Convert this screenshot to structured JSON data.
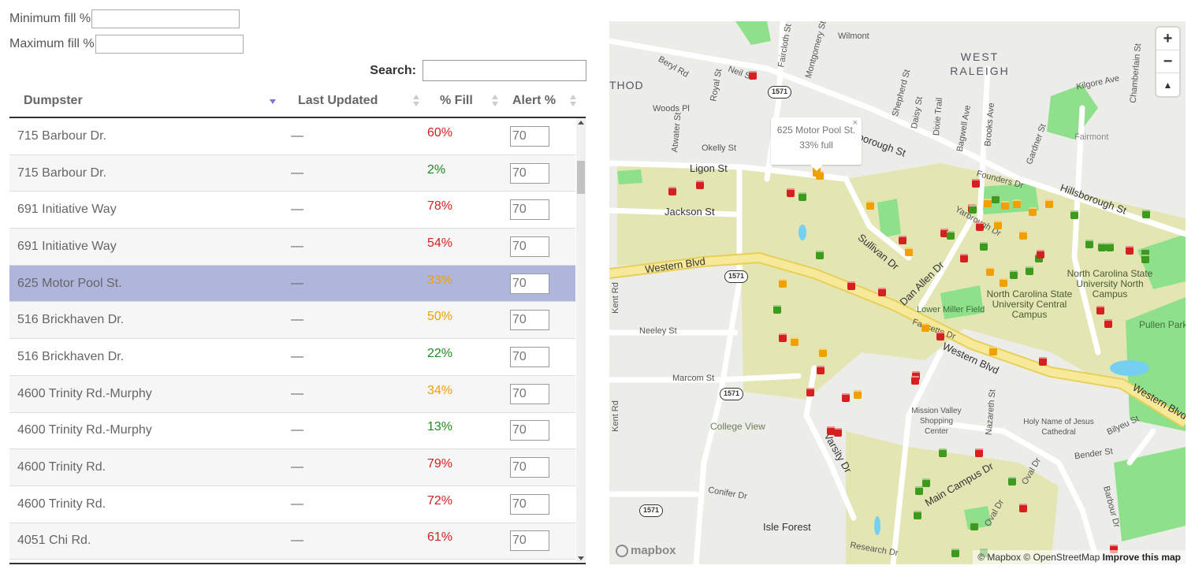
{
  "filters": {
    "min_label": "Minimum fill %",
    "max_label": "Maximum fill %",
    "search_label": "Search:",
    "min_value": "",
    "max_value": "",
    "search_value": ""
  },
  "table": {
    "columns": [
      "Dumpster",
      "Last Updated",
      "% Fill",
      "Alert %"
    ],
    "rows": [
      {
        "name": "715 Barbour Dr.",
        "updated": "—",
        "fill": "60%",
        "color": "#d62020",
        "alert": "70"
      },
      {
        "name": "715 Barbour Dr.",
        "updated": "—",
        "fill": "2%",
        "color": "#1e8a1e",
        "alert": "70"
      },
      {
        "name": "691 Initiative Way",
        "updated": "—",
        "fill": "78%",
        "color": "#d62020",
        "alert": "70"
      },
      {
        "name": "691 Initiative Way",
        "updated": "—",
        "fill": "54%",
        "color": "#d62020",
        "alert": "70"
      },
      {
        "name": "625 Motor Pool St.",
        "updated": "—",
        "fill": "33%",
        "color": "#f0a000",
        "alert": "70",
        "selected": true
      },
      {
        "name": "516 Brickhaven Dr.",
        "updated": "—",
        "fill": "50%",
        "color": "#f0a000",
        "alert": "70"
      },
      {
        "name": "516 Brickhaven Dr.",
        "updated": "—",
        "fill": "22%",
        "color": "#1e8a1e",
        "alert": "70"
      },
      {
        "name": "4600 Trinity Rd.-Murphy",
        "updated": "—",
        "fill": "34%",
        "color": "#f0a000",
        "alert": "70"
      },
      {
        "name": "4600 Trinity Rd.-Murphy",
        "updated": "—",
        "fill": "13%",
        "color": "#1e8a1e",
        "alert": "70"
      },
      {
        "name": "4600 Trinity Rd.",
        "updated": "—",
        "fill": "79%",
        "color": "#d62020",
        "alert": "70"
      },
      {
        "name": "4600 Trinity Rd.",
        "updated": "—",
        "fill": "72%",
        "color": "#d62020",
        "alert": "70"
      },
      {
        "name": "4051 Chi Rd.",
        "updated": "—",
        "fill": "61%",
        "color": "#d62020",
        "alert": "70"
      }
    ]
  },
  "map": {
    "popup_title": "625 Motor Pool St.",
    "popup_fill": "33% full",
    "popup_close": "×",
    "zoom_in": "+",
    "zoom_out": "−",
    "compass": "▲",
    "logo": "mapbox",
    "attribution": "© Mapbox © OpenStreetMap",
    "improve": "Improve this map",
    "labels": {
      "wilmont": "Wilmont",
      "west_raleigh": "WEST RALEIGH",
      "fairmont": "Fairmont",
      "beryl": "Beryl Rd",
      "neil": "Neil St",
      "fairclo": "Faircloth St",
      "montgomery": "Montgomery St",
      "royal": "Royal St",
      "woods": "Woods Pl",
      "ligon": "Ligon St",
      "okelly": "Okelly St",
      "jackson": "Jackson St",
      "atwater": "Atwater St",
      "western1": "Western Blvd",
      "western2": "Western Blvd",
      "western3": "Western Blvd",
      "sullivan": "Sullivan Dr",
      "dan_allen": "Dan Allen Dr",
      "hillsborough": "Hillsborough St",
      "founders": "Founders Dr",
      "yarbrough": "Yarbrough Dr",
      "kilgore": "Kilgore Ave",
      "neeley": "Neeley St",
      "marcom": "Marcom St",
      "kent1": "Kent Rd",
      "kent2": "Kent Rd",
      "college_view": "College View",
      "conifer": "Conifer Dr",
      "isle_forest": "Isle Forest",
      "varsity": "Varsity Dr",
      "main_campus": "Main Campus Dr",
      "research": "Research Dr",
      "oval1": "Oval Dr",
      "oval2": "Oval Dr",
      "bender": "Bender St",
      "barbour": "Barbour Dr",
      "bilyeu": "Bilyeu St",
      "nazareth": "Nazareth St",
      "faucette": "Faucette Dr",
      "lower_miller": "Lower Miller Field",
      "ncsu_central": "North Carolina State University Central Campus",
      "ncsu_north": "North Carolina State University North Campus",
      "pullen": "Pullen Park",
      "mission_valley": "Mission Valley Shopping Center",
      "holy_name": "Holy Name of Jesus Cathedral",
      "gardner": "Gardner St",
      "brooks": "Brooks Ave",
      "dixie": "Dixie Trail",
      "daisy": "Daisy St",
      "shepherd": "Shepherd St",
      "bagwell": "Bagwell Ave",
      "chamberlain": "Chamberlain St",
      "hod": "THOD",
      "route": "1571"
    }
  },
  "colors": {
    "red": "#d62020",
    "orange": "#f0a000",
    "green": "#3c9a1c",
    "selected": "#b0b5dc"
  }
}
